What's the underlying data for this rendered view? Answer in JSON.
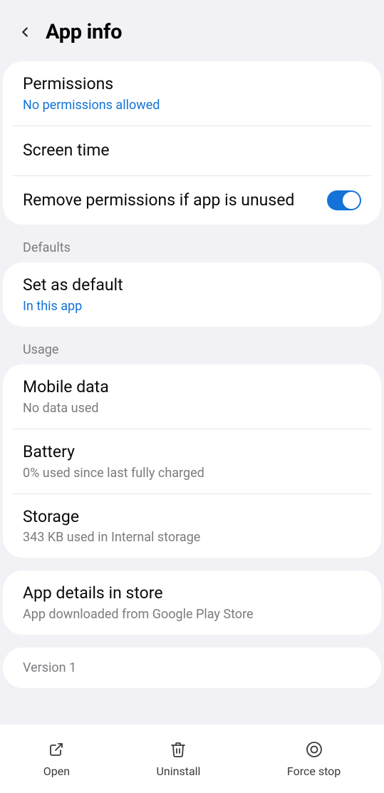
{
  "header": {
    "title": "App info"
  },
  "section1": {
    "permissions": {
      "label": "Permissions",
      "sub": "No permissions allowed"
    },
    "screen_time": {
      "label": "Screen time"
    },
    "remove_unused": {
      "label": "Remove permissions if app is unused",
      "toggled": true
    }
  },
  "sections": {
    "defaults_title": "Defaults",
    "usage_title": "Usage"
  },
  "defaults": {
    "set_default": {
      "label": "Set as default",
      "sub": "In this app"
    }
  },
  "usage": {
    "mobile_data": {
      "label": "Mobile data",
      "sub": "No data used"
    },
    "battery": {
      "label": "Battery",
      "sub": "0% used since last fully charged"
    },
    "storage": {
      "label": "Storage",
      "sub": "343 KB used in Internal storage"
    }
  },
  "store": {
    "label": "App details in store",
    "sub": "App downloaded from Google Play Store"
  },
  "version": {
    "text": "Version 1"
  },
  "bottom": {
    "open": "Open",
    "uninstall": "Uninstall",
    "force_stop": "Force stop"
  }
}
